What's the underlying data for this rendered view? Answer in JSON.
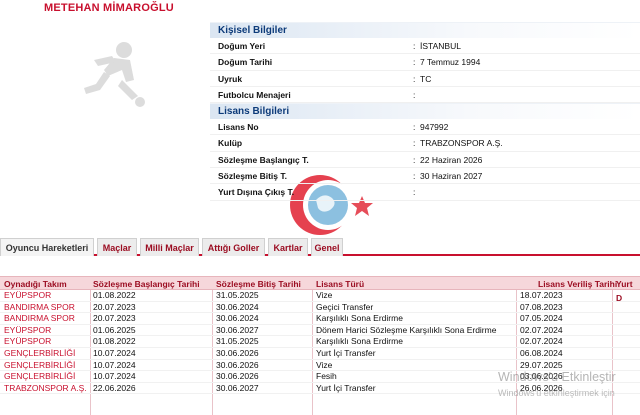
{
  "player": {
    "name": "METEHAN MİMAROĞLU"
  },
  "personal": {
    "title": "Kişisel Bilgiler",
    "rows": [
      {
        "label": "Doğum Yeri",
        "sep": ":",
        "value": "İSTANBUL"
      },
      {
        "label": "Doğum Tarihi",
        "sep": ":",
        "value": "7 Temmuz 1994"
      },
      {
        "label": "Uyruk",
        "sep": ":",
        "value": "TC"
      },
      {
        "label": "Futbolcu Menajeri",
        "sep": ":",
        "value": ""
      }
    ]
  },
  "license": {
    "title": "Lisans Bilgileri",
    "rows": [
      {
        "label": "Lisans No",
        "sep": ":",
        "value": "947992"
      },
      {
        "label": "Kulüp",
        "sep": ":",
        "value": "TRABZONSPOR A.Ş."
      },
      {
        "label": "Sözleşme Başlangıç T.",
        "sep": ":",
        "value": "22 Haziran 2026"
      },
      {
        "label": "Sözleşme Bitiş T.",
        "sep": ":",
        "value": "30 Haziran 2027"
      },
      {
        "label": "Yurt Dışına Çıkış T.",
        "sep": ":",
        "value": ""
      }
    ]
  },
  "tabs": [
    {
      "label": "Oyuncu Hareketleri",
      "active": true
    },
    {
      "label": "Maçlar"
    },
    {
      "label": "Milli Maçlar"
    },
    {
      "label": "Attığı Goller"
    },
    {
      "label": "Kartlar"
    },
    {
      "label": "Genel"
    }
  ],
  "table": {
    "headers": [
      "Oynadığı Takım",
      "Sözleşme Başlangıç Tarihi",
      "Sözleşme Bitiş Tarihi",
      "Lisans Türü",
      "Lisans Veriliş Tarihi",
      "Yurt D"
    ],
    "rows": [
      [
        "EYÜPSPOR",
        "01.08.2022",
        "31.05.2025",
        "Vize",
        "18.07.2023",
        ""
      ],
      [
        "BANDIRMA SPOR",
        "20.07.2023",
        "30.06.2024",
        "Geçici Transfer",
        "07.08.2023",
        ""
      ],
      [
        "BANDIRMA SPOR",
        "20.07.2023",
        "30.06.2024",
        "Karşılıklı Sona Erdirme",
        "07.05.2024",
        ""
      ],
      [
        "EYÜPSPOR",
        "01.06.2025",
        "30.06.2027",
        "Dönem Harici Sözleşme Karşılıklı Sona Erdirme",
        "02.07.2024",
        ""
      ],
      [
        "EYÜPSPOR",
        "01.08.2022",
        "31.05.2025",
        "Karşılıklı Sona Erdirme",
        "02.07.2024",
        ""
      ],
      [
        "GENÇLERBİRLİĞİ",
        "10.07.2024",
        "30.06.2026",
        "Yurt İçi Transfer",
        "06.08.2024",
        ""
      ],
      [
        "GENÇLERBİRLİĞİ",
        "10.07.2024",
        "30.06.2026",
        "Vize",
        "29.07.2025",
        ""
      ],
      [
        "GENÇLERBİRLİĞİ",
        "10.07.2024",
        "30.06.2026",
        "Fesih",
        "03.06.2026",
        ""
      ],
      [
        "TRABZONSPOR A.Ş.",
        "22.06.2026",
        "30.06.2027",
        "Yurt İçi Transfer",
        "26.06.2026",
        ""
      ]
    ]
  },
  "os_watermark": {
    "title": "Windows'u Etkinleştir",
    "subtitle": "Windows'u etkinleştirmek için"
  },
  "colors": {
    "accent": "#c8102e",
    "section_title": "#0d3b7a",
    "table_header_bg": "#f6d7db"
  }
}
